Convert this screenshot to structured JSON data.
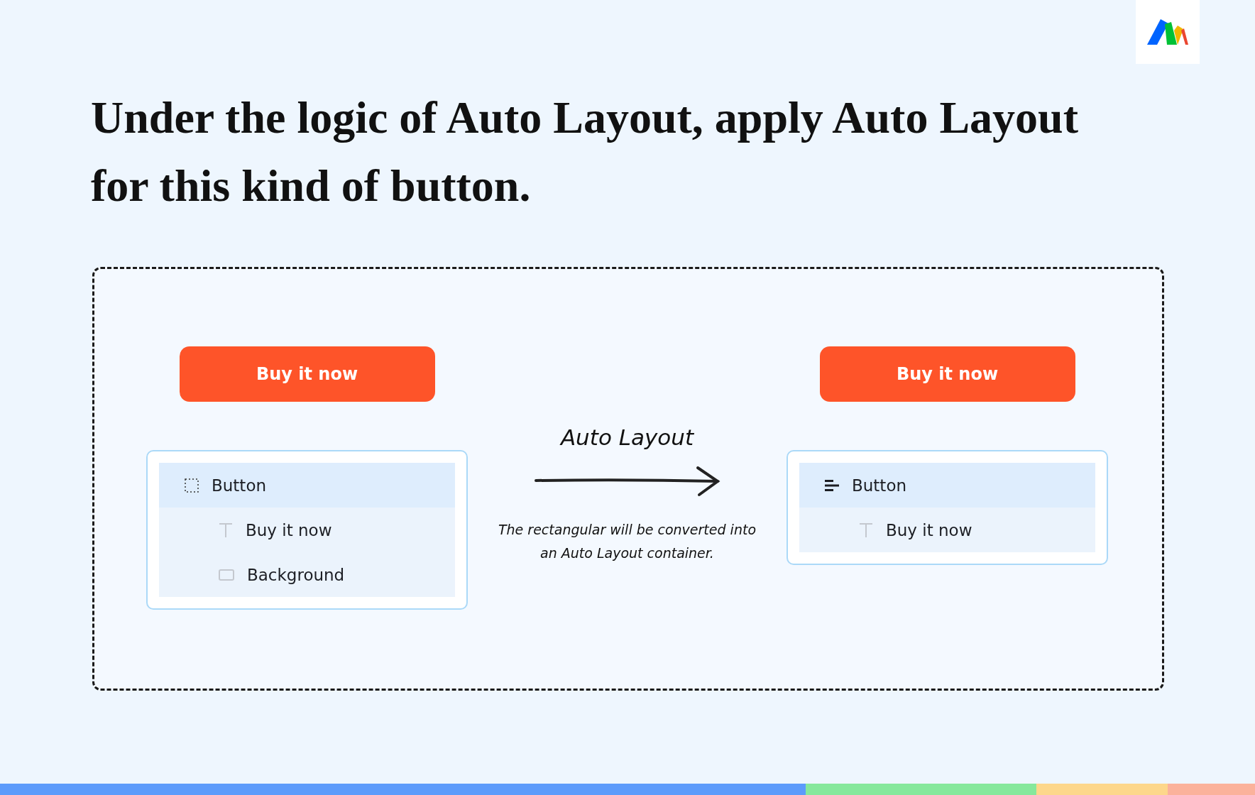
{
  "title": "Under the logic of Auto Layout, apply Auto Layout for this kind of button.",
  "panels": [
    {
      "button": "Buy it now",
      "layers": [
        {
          "kind": "frame",
          "name": "Button",
          "selected": true,
          "children": [
            {
              "kind": "text",
              "name": "Buy it now",
              "selected": false
            },
            {
              "kind": "rectangle",
              "name": "Background",
              "selected": false
            }
          ]
        }
      ]
    },
    {
      "button": "Buy it now",
      "layers": [
        {
          "kind": "autolayout",
          "name": "Button",
          "selected": true,
          "children": [
            {
              "kind": "text",
              "name": "Buy it now",
              "selected": false
            }
          ]
        }
      ]
    }
  ],
  "transition": {
    "label": "Auto Layout",
    "caption": "The rectangular will be converted into an Auto Layout container."
  }
}
